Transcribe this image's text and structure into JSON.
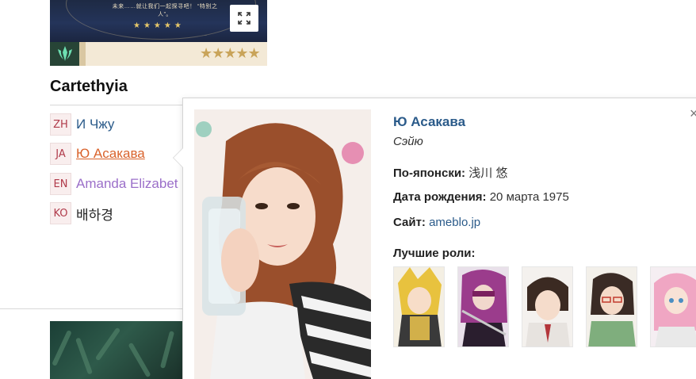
{
  "character": {
    "banner_caption": "未来……就让我们一起探寻吧！ “特别之人”。",
    "banner_mini_caption": "...",
    "banner_stars": "★★★★★",
    "rarity_stars": "★★★★★",
    "name": "Cartethyia",
    "expand_icon": "expand-icon",
    "element_icon": "aero-element-icon"
  },
  "voice_actors": [
    {
      "lang": "ZH",
      "name": "И Чжу"
    },
    {
      "lang": "JA",
      "name": "Ю Асакава"
    },
    {
      "lang": "EN",
      "name": "Amanda Elizabet"
    },
    {
      "lang": "KO",
      "name": "배하경"
    }
  ],
  "popup": {
    "close_label": "×",
    "name": "Ю Асакава",
    "role": "Сэйю",
    "japanese_label": "По-японски:",
    "japanese_value": "浅川 悠",
    "birth_label": "Дата рождения:",
    "birth_value": "20 марта 1975",
    "site_label": "Сайт:",
    "site_value": "ameblo.jp",
    "roles_title": "Лучшие роли:",
    "roles": [
      "role-1",
      "role-2",
      "role-3",
      "role-4",
      "role-5"
    ]
  },
  "colors": {
    "link_blue": "#2b5b8a",
    "ja_orange": "#d9622b",
    "en_purple": "#9b6fc9",
    "tag_red": "#b03a4a"
  }
}
